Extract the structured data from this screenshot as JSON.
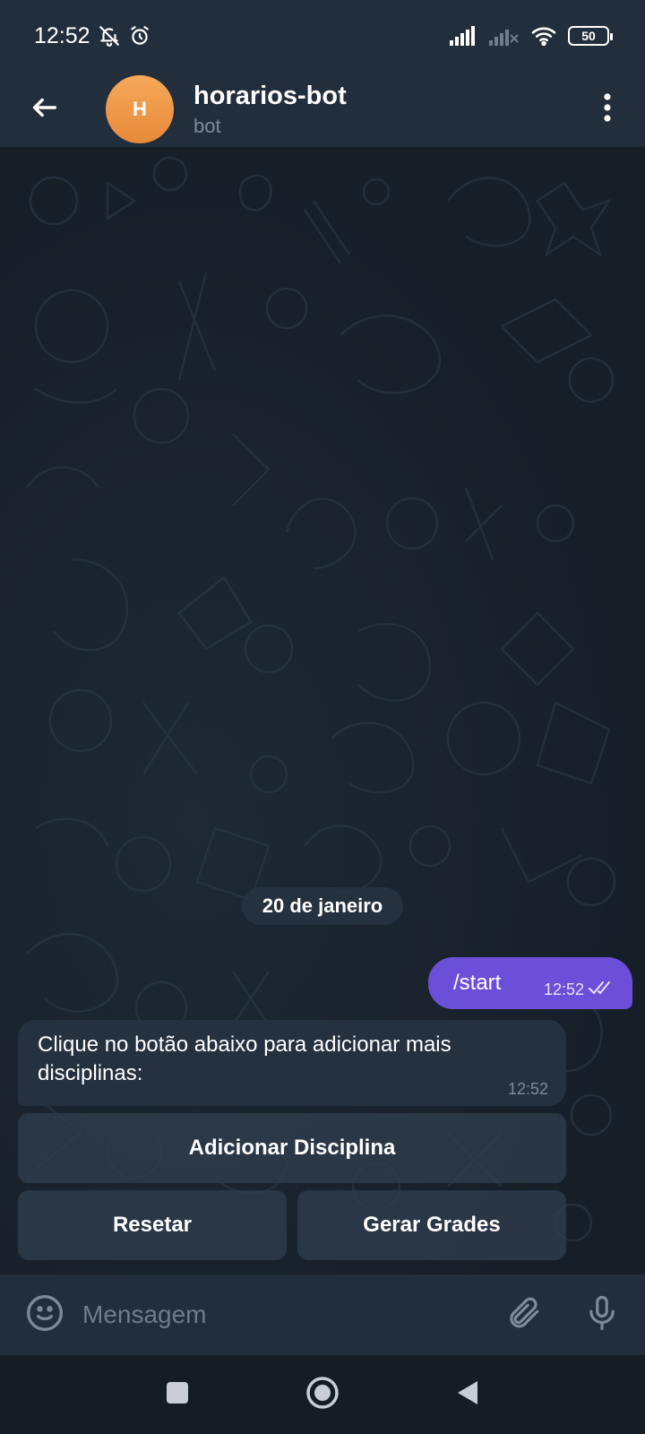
{
  "status_bar": {
    "time": "12:52",
    "battery": "50",
    "icons": [
      "bell-off-icon",
      "alarm-icon",
      "signal-icon",
      "signal-no-service-icon",
      "wifi-icon",
      "battery-icon"
    ]
  },
  "header": {
    "avatar_letter": "H",
    "title": "horarios-bot",
    "subtitle": "bot",
    "avatar_color": "#f0964a"
  },
  "chat": {
    "date_chip": "20 de janeiro",
    "outgoing": {
      "text": "/start",
      "time": "12:52",
      "status": "read-double-check"
    },
    "incoming": {
      "text": "Clique no botão abaixo para adicionar mais disciplinas:",
      "time": "12:52"
    },
    "keyboard": {
      "add_label": "Adicionar Disciplina",
      "reset_label": "Resetar",
      "generate_label": "Gerar Grades"
    }
  },
  "input": {
    "placeholder": "Mensagem",
    "value": ""
  },
  "colors": {
    "outgoing_bubble": "#6c4fd8",
    "incoming_bubble": "#263140",
    "header_bg": "#232e3c",
    "chat_bg": "#1a2330"
  }
}
